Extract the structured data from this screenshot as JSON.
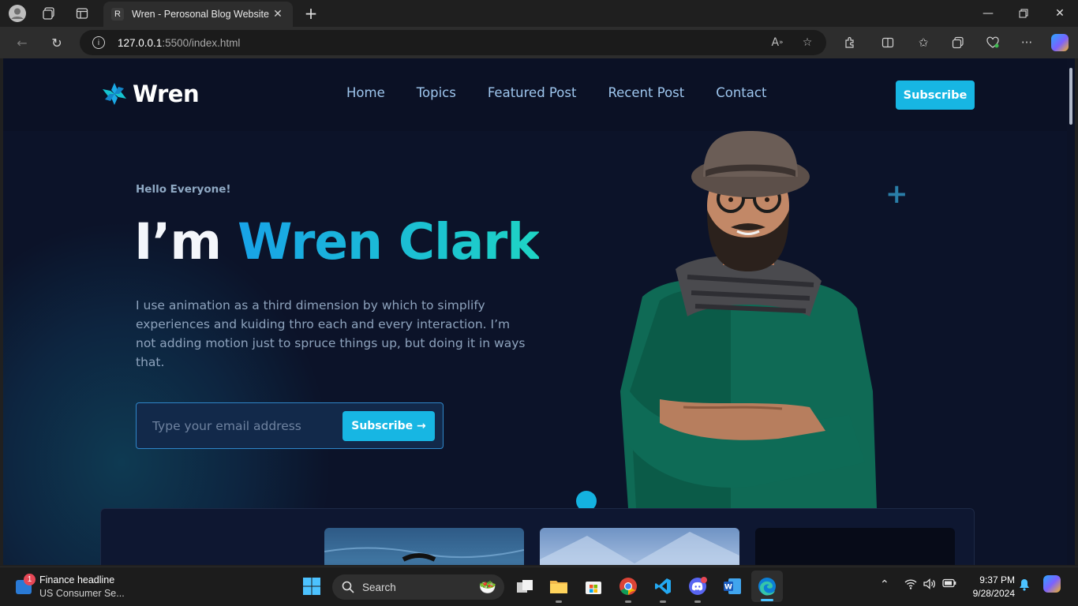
{
  "browser": {
    "tab_title": "Wren - Perosonal Blog Website",
    "tab_favicon": "R",
    "url_host": "127.0.0.1",
    "url_path": ":5500/index.html"
  },
  "site": {
    "logo_text": "Wren",
    "nav": [
      "Home",
      "Topics",
      "Featured Post",
      "Recent Post",
      "Contact"
    ],
    "header_button": "Subscribe",
    "accent_color": "#17b6e3",
    "background_color": "#0c1226"
  },
  "hero": {
    "greeting": "Hello Everyone!",
    "headline_prefix": "I’m ",
    "headline_name": "Wren Clark",
    "intro": "I use animation as a third dimension by which to simplify experiences and kuiding thro each and every interaction. I’m not adding motion just to spruce things up, but doing it in ways that.",
    "email_placeholder": "Type your email address",
    "email_button": "Subscribe →"
  },
  "taskbar": {
    "news_badge": "1",
    "news_title": "Finance headline",
    "news_subtitle": "US Consumer Se...",
    "search_label": "Search",
    "time": "9:37 PM",
    "date": "9/28/2024"
  }
}
